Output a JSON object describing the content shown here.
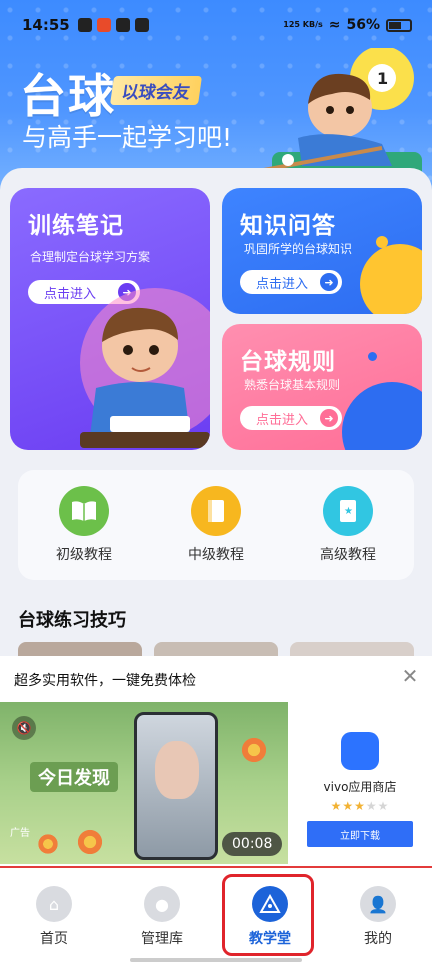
{
  "status_bar": {
    "time": "14:55",
    "network_speed": "125 KB/s",
    "battery": "56%"
  },
  "header": {
    "title": "台球",
    "tag": "以球会友",
    "subtitle": "与高手一起学习吧!"
  },
  "cards": {
    "train": {
      "title": "训练笔记",
      "desc": "合理制定台球学习方案",
      "button": "点击进入"
    },
    "knowledge": {
      "title": "知识问答",
      "desc": "巩固所学的台球知识",
      "button": "点击进入"
    },
    "rules": {
      "title": "台球规则",
      "desc": "熟悉台球基本规则",
      "button": "点击进入"
    }
  },
  "tutorials": [
    {
      "label": "初级教程",
      "icon": "book-open-icon",
      "color": "#6cc04a"
    },
    {
      "label": "中级教程",
      "icon": "book-icon",
      "color": "#f7b71f"
    },
    {
      "label": "高级教程",
      "icon": "book-star-icon",
      "color": "#31c6e2"
    }
  ],
  "section": {
    "title": "台球练习技巧"
  },
  "ad": {
    "headline": "超多实用软件，一键免费体检",
    "video_text": "今日发现",
    "ad_label": "广告",
    "timer": "00:08",
    "app_name": "vivo应用商店",
    "download": "立即下载"
  },
  "nav": [
    {
      "label": "首页",
      "icon": "home-icon",
      "active": false
    },
    {
      "label": "管理库",
      "icon": "billiard-ball-icon",
      "active": false
    },
    {
      "label": "教学堂",
      "icon": "triangle-rack-icon",
      "active": true
    },
    {
      "label": "我的",
      "icon": "user-icon",
      "active": false
    }
  ],
  "colors": {
    "primary": "#3d8bff",
    "train_card": "#7a55f7",
    "knowledge_card": "#2f73f5",
    "rules_card": "#ff7aa0",
    "active_nav": "#1c63d9",
    "highlight": "#e0242b"
  }
}
